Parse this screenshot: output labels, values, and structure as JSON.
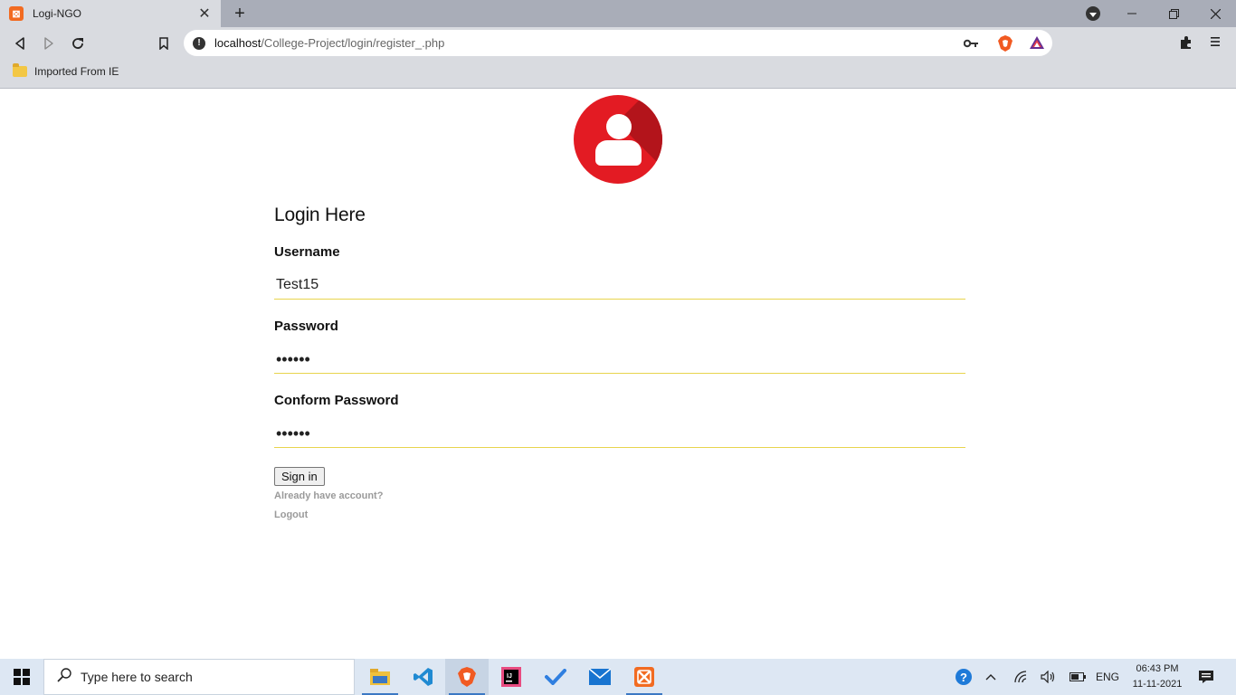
{
  "browser": {
    "tab_title": "Logi-NGO",
    "tab_favicon": "xampp-icon",
    "url_host": "localhost",
    "url_path": "/College-Project/login/register_.php",
    "bookmark_label": "Imported From IE"
  },
  "form": {
    "title": "Login Here",
    "username_label": "Username",
    "username_value": "Test15",
    "password_label": "Password",
    "password_value": "••••••",
    "confirm_label": "Conform Password",
    "confirm_value": "••••••",
    "signin_label": "Sign in",
    "already_link": "Already have account?",
    "logout_link": "Logout"
  },
  "colors": {
    "avatar_bg": "#e31b23",
    "input_underline": "#e8d44d"
  },
  "taskbar": {
    "search_placeholder": "Type here to search",
    "apps": [
      "file-explorer-icon",
      "vscode-icon",
      "brave-icon",
      "intellij-icon",
      "todo-icon",
      "mail-icon",
      "xampp-icon"
    ],
    "lang": "ENG",
    "time": "06:43 PM",
    "date": "11-11-2021"
  }
}
